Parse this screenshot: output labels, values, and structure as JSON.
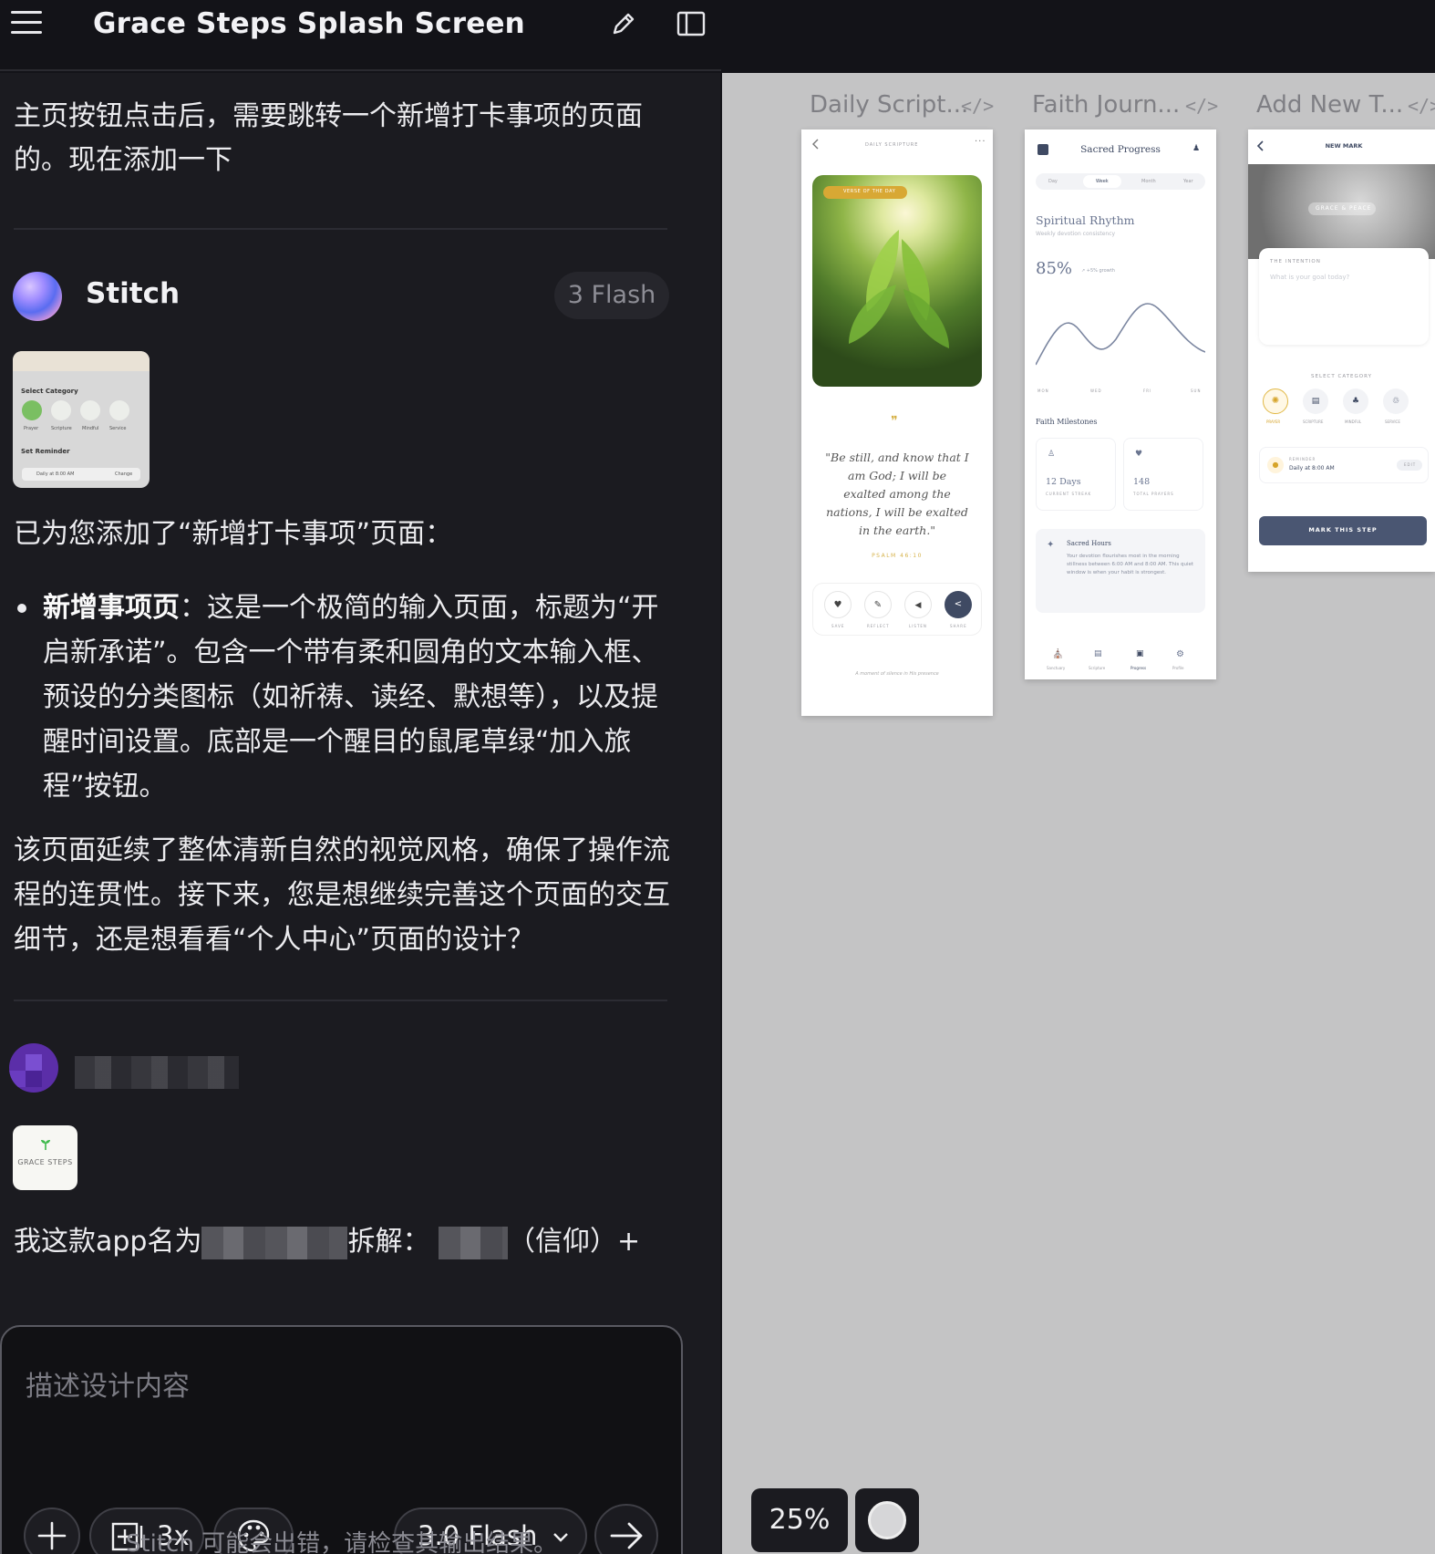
{
  "header": {
    "title": "Grace Steps Splash Screen"
  },
  "chat": {
    "user_prompt": "主页按钮点击后，需要跳转一个新增打卡事项的页面的。现在添加一下",
    "agent": {
      "name": "Stitch",
      "model_badge": "3 Flash"
    },
    "thumbnail": {
      "select_category": "Select Category",
      "categories": [
        "Prayer",
        "Scripture",
        "Mindful",
        "Service"
      ],
      "set_reminder": "Set Reminder",
      "reminder_value": "Daily at 8:00 AM",
      "change": "Change"
    },
    "reply_intro": "已为您添加了“新增打卡事项”页面：",
    "bullet_title": "新增事项页",
    "bullet_body": "：这是一个极简的输入页面，标题为“开启新承诺”。包含一个带有柔和圆角的文本输入框、预设的分类图标（如祈祷、读经、默想等），以及提醒时间设置。底部是一个醒目的鼠尾草绿“加入旅程”按钮。",
    "follow_up": "该页面延续了整体清新自然的视觉风格，确保了操作流程的连贯性。接下来，您是想继续完善这个页面的交互细节，还是想看看“个人中心”页面的设计？",
    "app_icon_label": "GRACE STEPS",
    "user_msg_prefix": "我这款app名为",
    "user_msg_mid": "拆解：",
    "user_msg_suffix": "（信仰）+"
  },
  "composer": {
    "placeholder": "描述设计内容",
    "frames_count": "3x",
    "model": "3.0 Flash",
    "disclaimer": "Stitch 可能会出错，请检查其输出结果。"
  },
  "canvas": {
    "zoom": "25%",
    "frames": [
      {
        "title": "Daily Script...",
        "header": "DAILY SCRIPTURE",
        "badge": "VERSE OF THE DAY",
        "quote": "\"Be still, and know that I am God; I will be exalted among the nations, I will be exalted in the earth.\"",
        "reference": "PSALM 46:10",
        "actions": [
          "SAVE",
          "REFLECT",
          "LISTEN",
          "SHARE"
        ],
        "footer": "A moment of silence in His presence"
      },
      {
        "title": "Faith Journ...",
        "header": "Sacred Progress",
        "tabs": [
          "Day",
          "Week",
          "Month",
          "Year"
        ],
        "section": "Spiritual Rhythm",
        "section_sub": "Weekly devotion consistency",
        "percent": "85%",
        "growth": "↗ +5% growth",
        "axis": [
          "MON",
          "WED",
          "FRI",
          "SUN"
        ],
        "milestones_title": "Faith Milestones",
        "streak_value": "12 Days",
        "streak_label": "CURRENT STREAK",
        "prayers_value": "148",
        "prayers_label": "TOTAL PRAYERS",
        "hours_title": "Sacred Hours",
        "hours_text": "Your devotion flourishes most in the morning stillness between 6:00 AM and 8:00 AM. This quiet window is when your habit is strongest.",
        "nav": [
          "Sanctuary",
          "Scripture",
          "Progress",
          "Profile"
        ]
      },
      {
        "title": "Add New T...",
        "header": "NEW MARK",
        "hero_label": "GRACE & PEACE",
        "intention_label": "THE INTENTION",
        "intention_placeholder": "What is your goal today?",
        "category_label": "SELECT CATEGORY",
        "categories": [
          "PRAYER",
          "SCRIPTURE",
          "MINDFUL",
          "SERVICE"
        ],
        "reminder_label": "REMINDER",
        "reminder_value": "Daily at 8:00 AM",
        "edit": "EDIT",
        "cta": "MARK THIS STEP"
      }
    ]
  }
}
